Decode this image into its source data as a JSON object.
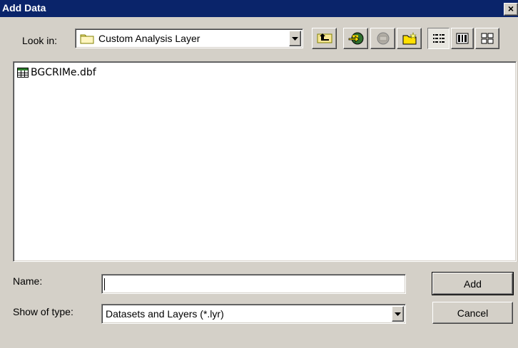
{
  "window": {
    "title": "Add Data",
    "close_icon": "close-icon"
  },
  "look_in": {
    "label": "Look in:",
    "value": "Custom Analysis Layer",
    "icon": "folder-icon"
  },
  "toolbar": {
    "buttons": [
      {
        "icon": "up-one-level-icon"
      },
      {
        "icon": "connect-to-folder-icon"
      },
      {
        "icon": "disconnect-from-folder-icon",
        "disabled": true
      },
      {
        "icon": "new-folder-icon"
      },
      {
        "icon": "list-view-icon",
        "pressed": true
      },
      {
        "icon": "details-view-icon"
      },
      {
        "icon": "thumbnails-view-icon"
      }
    ]
  },
  "file_list": {
    "items": [
      {
        "name": "BGCRIMe.dbf",
        "icon": "table-icon"
      }
    ]
  },
  "name_field": {
    "label": "Name:",
    "value": ""
  },
  "show_of_type": {
    "label": "Show of type:",
    "value": "Datasets and Layers (*.lyr)"
  },
  "buttons": {
    "add": "Add",
    "cancel": "Cancel"
  },
  "colors": {
    "face": "#d4d0c8",
    "titlebar": "#0a246a",
    "folder": "#f7e795"
  }
}
